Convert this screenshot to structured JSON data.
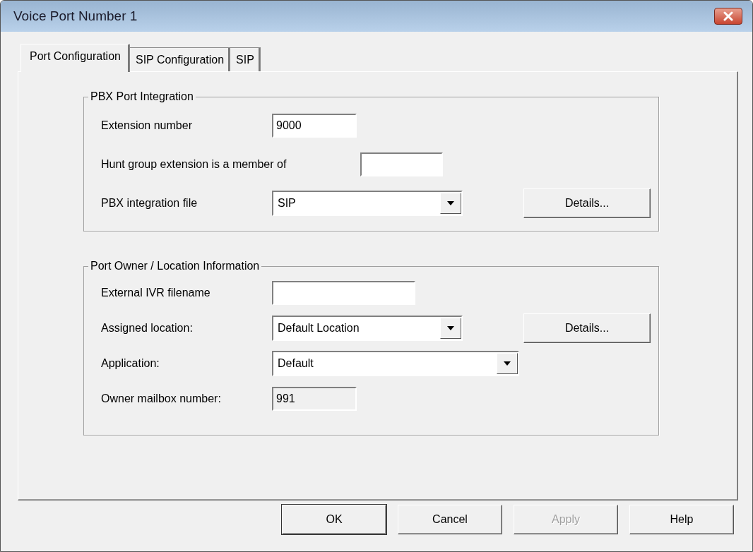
{
  "window": {
    "title": "Voice Port Number 1"
  },
  "tabs": [
    {
      "label": "Port Configuration",
      "selected": true
    },
    {
      "label": "SIP Configuration",
      "selected": false
    },
    {
      "label": "SIP",
      "selected": false
    }
  ],
  "groups": [
    {
      "title": "PBX Port Integration",
      "rows": [
        {
          "label": "Extension number",
          "kind": "text",
          "value": "9000",
          "disabled": false
        },
        {
          "label": "Hunt group extension is a member of",
          "kind": "text",
          "value": "",
          "disabled": false
        },
        {
          "label": "PBX integration file",
          "kind": "combo",
          "value": "SIP",
          "disabled": false,
          "button": "Details..."
        }
      ]
    },
    {
      "title": "Port Owner / Location Information",
      "rows": [
        {
          "label": "External IVR filename",
          "kind": "text",
          "value": "",
          "disabled": false
        },
        {
          "label": "Assigned location:",
          "kind": "combo",
          "value": "Default Location",
          "disabled": false,
          "button": "Details..."
        },
        {
          "label": "Application:",
          "kind": "combo",
          "value": "Default",
          "disabled": false
        },
        {
          "label": "Owner mailbox number:",
          "kind": "text",
          "value": "991",
          "disabled": true
        }
      ]
    }
  ],
  "buttons": [
    {
      "label": "OK",
      "disabled": false,
      "default": true
    },
    {
      "label": "Cancel",
      "disabled": false,
      "default": false
    },
    {
      "label": "Apply",
      "disabled": true,
      "default": false
    },
    {
      "label": "Help",
      "disabled": false,
      "default": false
    }
  ]
}
